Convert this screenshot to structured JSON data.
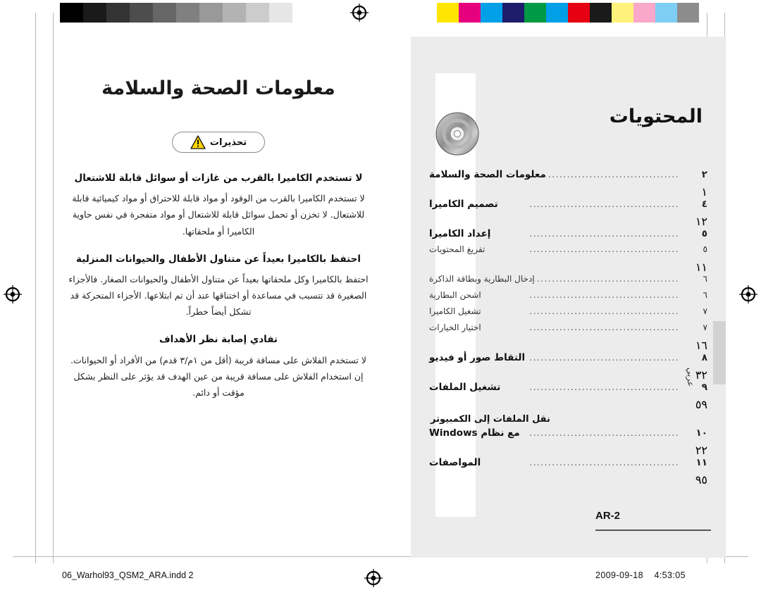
{
  "print_marks": {
    "gray_bar": [
      "#000000",
      "#1a1a1a",
      "#333333",
      "#4d4d4d",
      "#666666",
      "#808080",
      "#999999",
      "#b3b3b3",
      "#cccccc",
      "#e6e6e6",
      "#ffffff"
    ],
    "color_bar": [
      "#ffe600",
      "#e6007e",
      "#00a0e9",
      "#1d1d6b",
      "#009944",
      "#00a0e9",
      "#e60012",
      "#1a1a1a",
      "#fff27a",
      "#f9a8c9",
      "#7ecef4",
      "#8c8c8c"
    ]
  },
  "left_page": {
    "title": "معلومات الصحة والسلامة",
    "badge": {
      "label": "تحذيرات",
      "icon": "warning-triangle-icon"
    },
    "sections": [
      {
        "heading": "لا تستخدم الكاميرا بالقرب من غازات أو سوائل قابلة للاشتعال",
        "body": "لا تستخدم الكاميرا بالقرب من الوقود أو مواد قابلة للاحتراق أو مواد كيميائية قابلة للاشتعال. لا تخزن أو تحمل سوائل قابلة للاشتعال أو مواد متفجرة في نفس حاوية الكاميرا أو ملحقاتها."
      },
      {
        "heading": "احتفظ بالكاميرا بعيداً عن متناول الأطفال والحيوانات المنزلية",
        "body": "احتفظ بالكاميرا وكل ملحقاتها بعيداً عن متناول الأطفال والحيوانات الصغار. فالأجزاء الصغيرة قد تتسبب في مساعدة أو اختناقها عند أن تم ابتلاعها. الأجزاء المتحركة قد تشكل أيضاً خطراً."
      },
      {
        "heading": "تفادي إصابة نظر الأهداف",
        "body": "لا تستخدم الفلاش على مسافة قريبة (أقل من ١م/٣ قدم) من الأفراد أو الحيوانات. إن استخدام الفلاش على مسافة قريبة من عين الهدف قد يؤثر على النظر بشكل مؤقت أو دائم."
      }
    ]
  },
  "right_page": {
    "title": "المحتويات",
    "icon": "cd-disc-icon",
    "entries": [
      {
        "side_num": "١",
        "num": "٢",
        "label": "معلومات الصحة والسلامة",
        "style": "bold"
      },
      {
        "side_num": "١٢",
        "num": "٤",
        "label": "تصميم الكاميرا",
        "style": "bold"
      },
      {
        "side_num": "",
        "num": "٥",
        "label": "إعداد الكاميرا",
        "style": "bold"
      },
      {
        "side_num": "١١",
        "num": "٥",
        "label": "تفريغ المحتويات",
        "style": "sub"
      },
      {
        "side_num": "",
        "num": "٦",
        "label": "إدخال البطارية وبطاقة الذاكرة",
        "style": "sub"
      },
      {
        "side_num": "",
        "num": "٦",
        "label": "اشحن البطارية",
        "style": "sub"
      },
      {
        "side_num": "",
        "num": "٧",
        "label": "تشغيل الكاميرا",
        "style": "sub"
      },
      {
        "side_num": "١٦",
        "num": "٧",
        "label": "اختيار الخيارات",
        "style": "sub"
      },
      {
        "side_num": "٣٢",
        "num": "٨",
        "label": "التقاط صور أو فيديو",
        "style": "bold"
      },
      {
        "side_num": "٥٩",
        "num": "٩",
        "label": "تشغيل الملفات",
        "style": "bold"
      },
      {
        "side_num": "",
        "num": "",
        "label": "نقل الملفات إلى الكمبيوتر",
        "style": "group"
      },
      {
        "side_num": "٢٢",
        "num": "١٠",
        "label": "مع نظام Windows",
        "style": "bold"
      },
      {
        "side_num": "٩٥",
        "num": "١١",
        "label": "المواصفات",
        "style": "bold"
      }
    ],
    "page_label": "AR-2",
    "side_text": "عربي"
  },
  "footer": {
    "left": "06_Warhol93_QSM2_ARA.indd   2",
    "date": "2009-09-18",
    "time": "4:53:05"
  }
}
